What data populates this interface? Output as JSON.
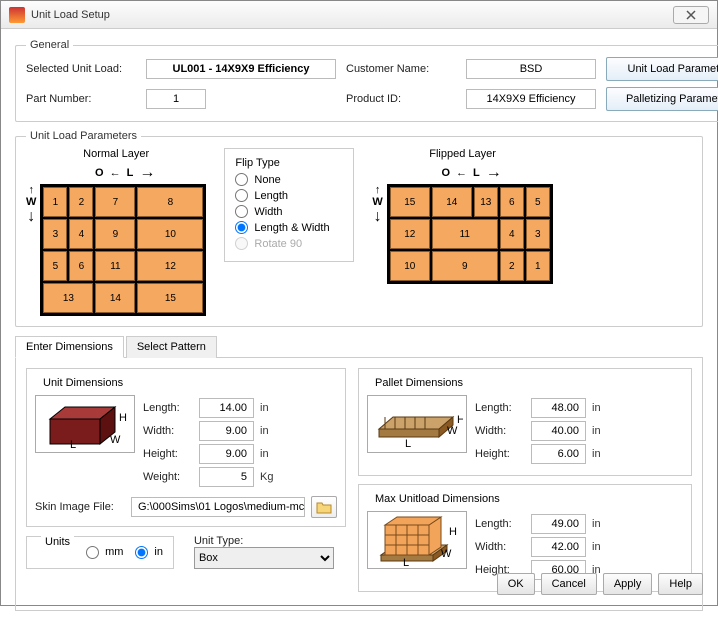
{
  "window": {
    "title": "Unit Load Setup"
  },
  "general": {
    "legend": "General",
    "selected_unit_load_label": "Selected Unit Load:",
    "selected_unit_load": "UL001 - 14X9X9 Efficiency",
    "customer_name_label": "Customer Name:",
    "customer_name": "BSD",
    "part_number_label": "Part Number:",
    "part_number": "1",
    "product_id_label": "Product ID:",
    "product_id": "14X9X9 Efficiency",
    "btn_params": "Unit Load Parameters",
    "btn_pallet": "Palletizing Parameters"
  },
  "params": {
    "legend": "Unit Load Parameters",
    "normal_label": "Normal Layer",
    "flipped_label": "Flipped Layer",
    "O": "O",
    "L": "L",
    "W": "W",
    "normal_cells": [
      "1",
      "2",
      "7",
      "8",
      "3",
      "4",
      "9",
      "10",
      "5",
      "6",
      "11",
      "12",
      "13",
      "14",
      "15"
    ],
    "flipped_cells": [
      "15",
      "14",
      "13",
      "6",
      "5",
      "12",
      "11",
      "4",
      "3",
      "10",
      "9",
      "2",
      "1"
    ],
    "flip": {
      "legend": "Flip Type",
      "none": "None",
      "length": "Length",
      "width": "Width",
      "lw": "Length & Width",
      "rotate": "Rotate 90",
      "selected": "lw"
    }
  },
  "tabs": {
    "dims": "Enter Dimensions",
    "pattern": "Select Pattern"
  },
  "unitdims": {
    "legend": "Unit Dimensions",
    "length_label": "Length:",
    "length": "14.00",
    "width_label": "Width:",
    "width": "9.00",
    "height_label": "Height:",
    "height": "9.00",
    "weight_label": "Weight:",
    "weight": "5",
    "in": "in",
    "kg": "Kg",
    "skin_label": "Skin Image File:",
    "skin_path": "G:\\000Sims\\01 Logos\\medium-mc"
  },
  "units": {
    "legend": "Units",
    "mm": "mm",
    "in": "in",
    "type_label": "Unit Type:",
    "type_value": "Box"
  },
  "palletdims": {
    "legend": "Pallet Dimensions",
    "length_label": "Length:",
    "length": "48.00",
    "width_label": "Width:",
    "width": "40.00",
    "height_label": "Height:",
    "height": "6.00",
    "in": "in"
  },
  "maxdims": {
    "legend": "Max Unitload Dimensions",
    "length_label": "Length:",
    "length": "49.00",
    "width_label": "Width:",
    "width": "42.00",
    "height_label": "Height:",
    "height": "60.00",
    "in": "in"
  },
  "footer": {
    "ok": "OK",
    "cancel": "Cancel",
    "apply": "Apply",
    "help": "Help"
  }
}
